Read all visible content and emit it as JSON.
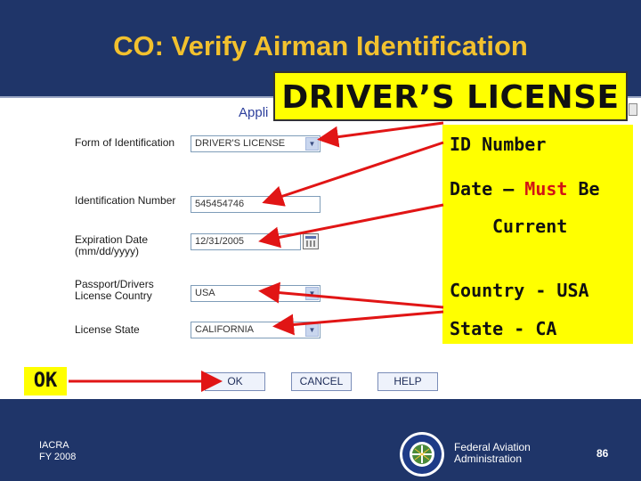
{
  "slide": {
    "title": "CO: Verify Airman Identification",
    "form_header_partial": "Appli",
    "footer_left_line1": "IACRA",
    "footer_left_line2": "FY 2008",
    "footer_org_line1": "Federal Aviation",
    "footer_org_line2": "Administration",
    "page_number": "86"
  },
  "form": {
    "fields": [
      {
        "label": "Form of Identification",
        "value": "DRIVER'S LICENSE",
        "type": "select"
      },
      {
        "label": "Identification Number",
        "value": "545454746",
        "type": "text"
      },
      {
        "label_line1": "Expiration Date",
        "label_line2": "(mm/dd/yyyy)",
        "value": "12/31/2005",
        "type": "date"
      },
      {
        "label_line1": "Passport/Drivers",
        "label_line2": "License Country",
        "value": "USA",
        "type": "select"
      },
      {
        "label": "License State",
        "value": "CALIFORNIA",
        "type": "select"
      }
    ],
    "buttons": {
      "ok": "OK",
      "cancel": "CANCEL",
      "help": "HELP"
    }
  },
  "callouts": {
    "title": "DRIVER’S LICENSE",
    "id_number": "ID Number",
    "date_prefix": "Date –",
    "date_must": "Must",
    "date_suffix": "Be",
    "date_line2": "Current",
    "country": "Country - USA",
    "state": "State - CA",
    "ok": "OK"
  },
  "colors": {
    "background": "#1f3569",
    "title": "#f2c12e",
    "callout_fill": "#ffff00",
    "arrow": "#e11515",
    "highlight_text": "#d21414"
  }
}
